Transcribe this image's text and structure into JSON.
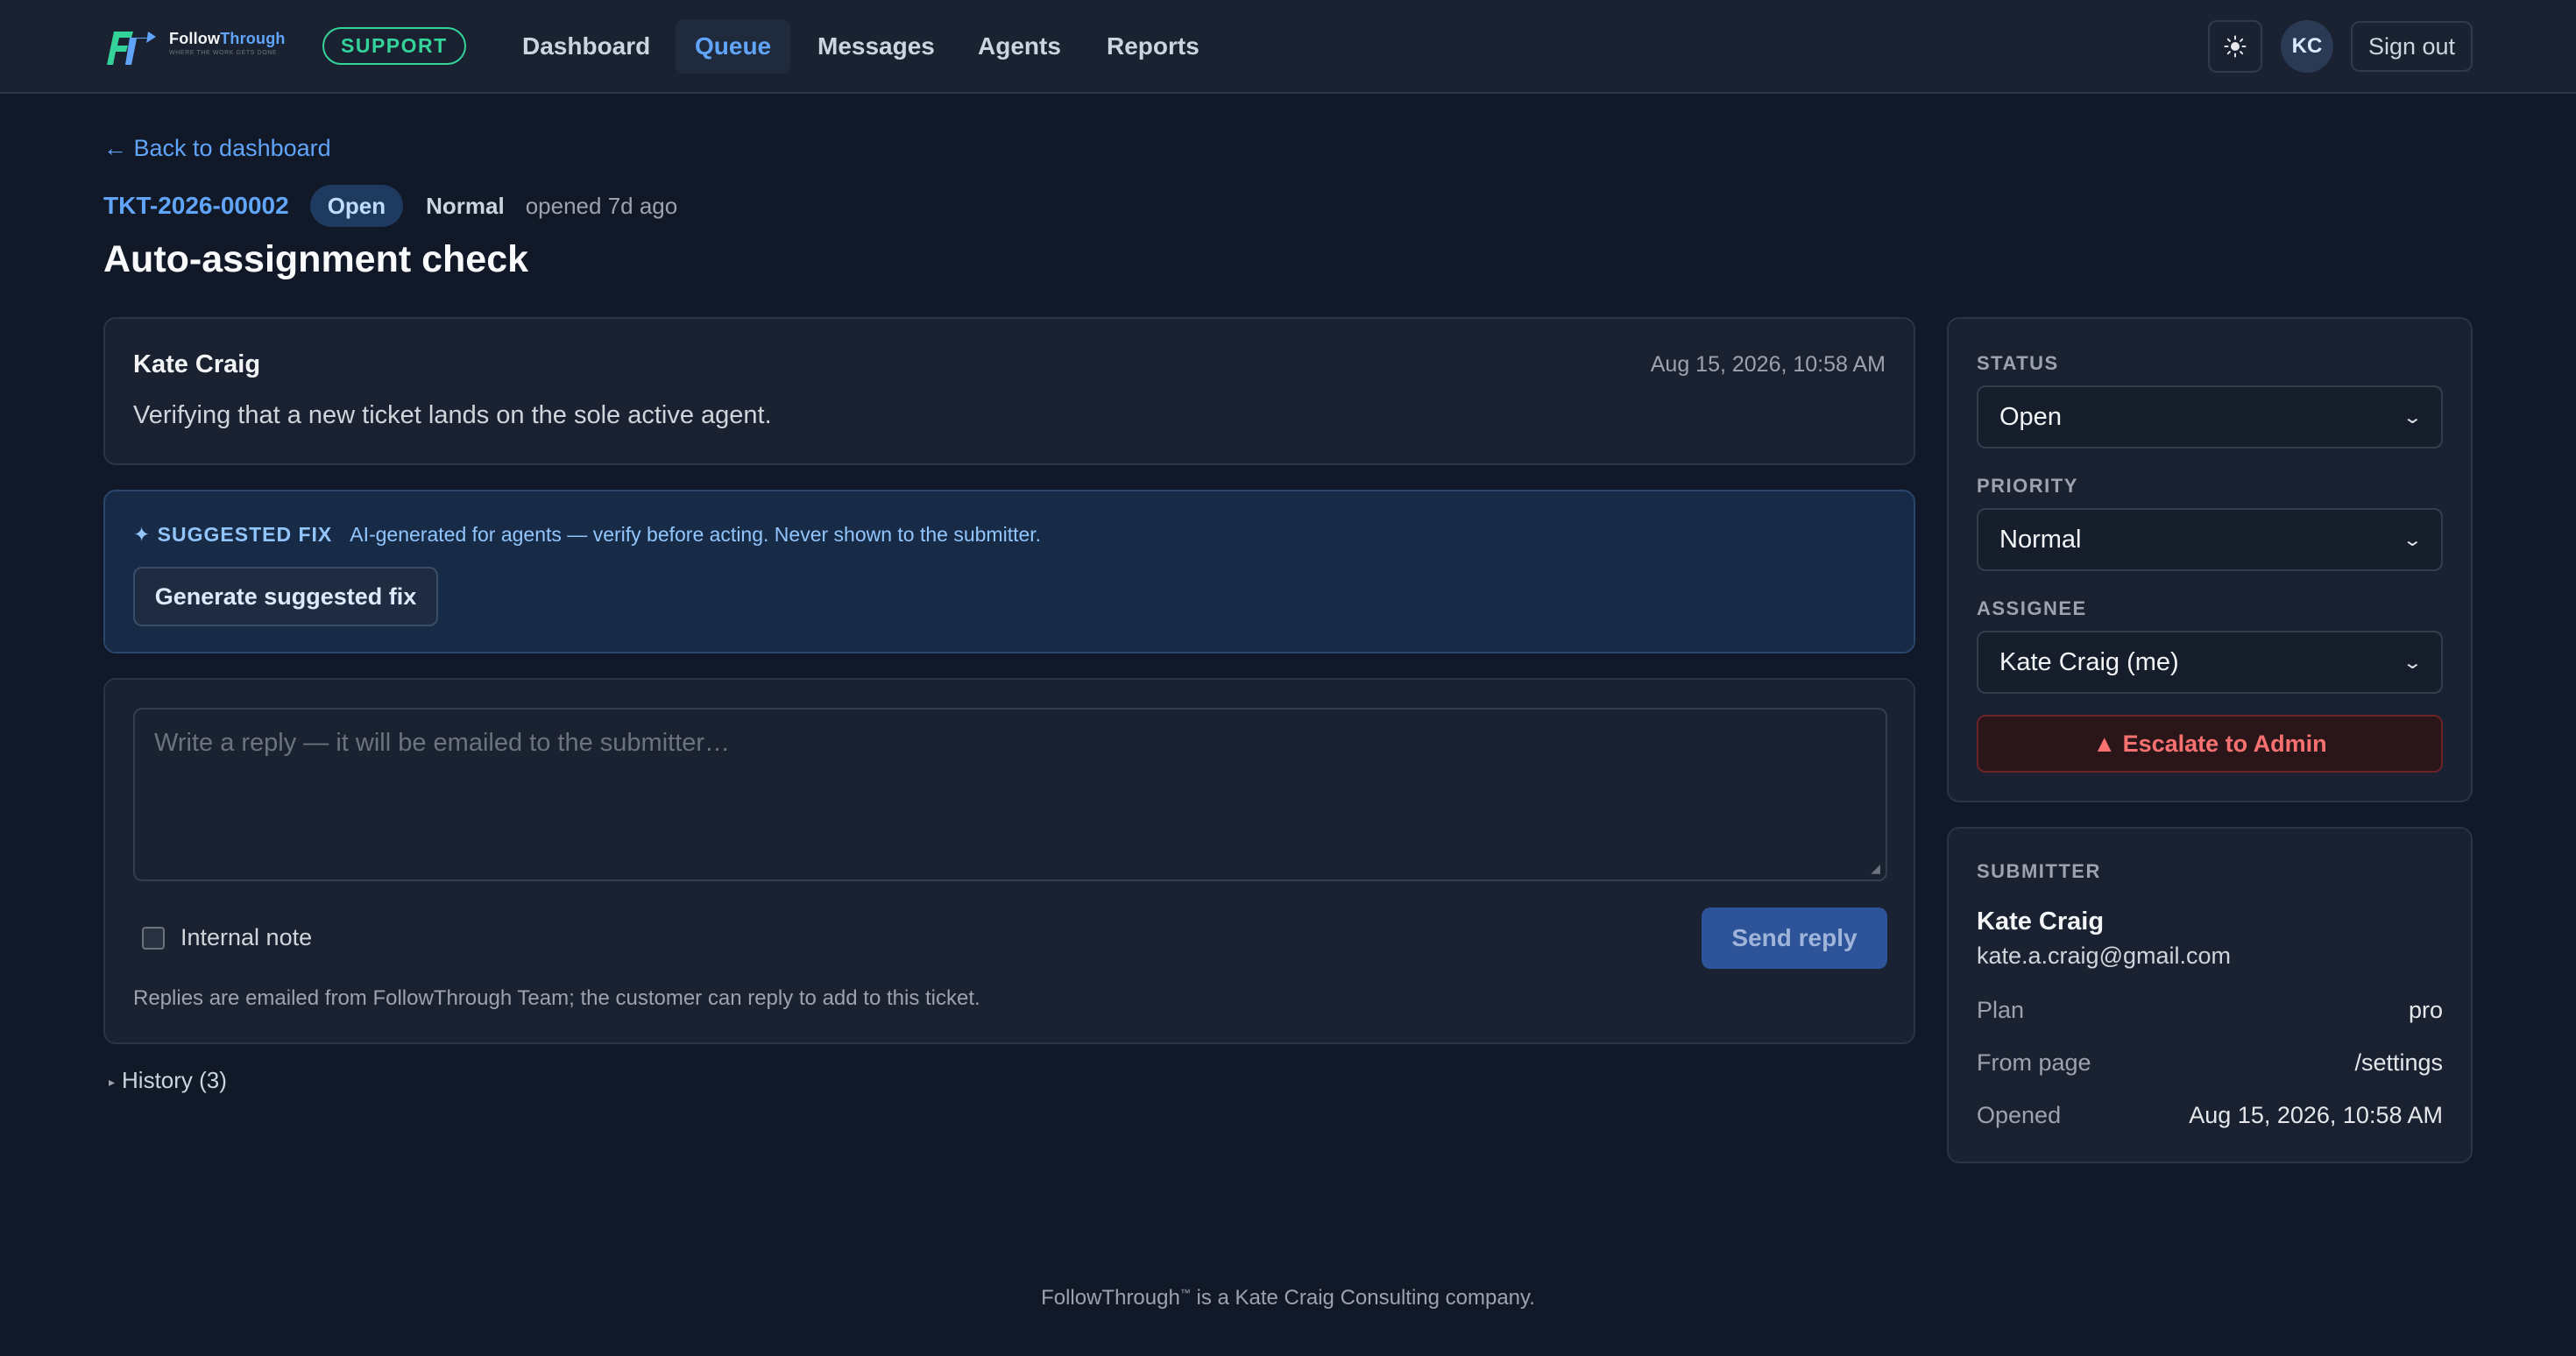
{
  "header": {
    "brand": {
      "name_part1": "Follow",
      "name_part2": "Through",
      "tagline": "WHERE THE WORK GETS DONE",
      "logo_initials": "FT"
    },
    "badge": "SUPPORT",
    "nav": [
      {
        "label": "Dashboard",
        "active": false
      },
      {
        "label": "Queue",
        "active": true
      },
      {
        "label": "Messages",
        "active": false
      },
      {
        "label": "Agents",
        "active": false
      },
      {
        "label": "Reports",
        "active": false
      }
    ],
    "theme_icon": "sun-icon",
    "avatar_initials": "KC",
    "signout_label": "Sign out"
  },
  "page": {
    "back_label": "← Back to dashboard",
    "ticket_id": "TKT-2026-00002",
    "status": "Open",
    "priority": "Normal",
    "opened": "opened 7d ago",
    "title": "Auto-assignment check"
  },
  "message": {
    "author": "Kate Craig",
    "time": "Aug 15, 2026, 10:58 AM",
    "body": "Verifying that a new ticket lands on the sole active agent."
  },
  "suggested_fix": {
    "label": "✦ SUGGESTED FIX",
    "note": "AI-generated for agents — verify before acting. Never shown to the submitter.",
    "button": "Generate suggested fix"
  },
  "reply": {
    "placeholder": "Write a reply — it will be emailed to the submitter…",
    "internal_note_label": "Internal note",
    "internal_note_checked": false,
    "send_label": "Send reply",
    "hint": "Replies are emailed from FollowThrough Team; the customer can reply to add to this ticket."
  },
  "history_label": "History (3)",
  "sidebar": {
    "status": {
      "label": "STATUS",
      "value": "Open"
    },
    "priority": {
      "label": "PRIORITY",
      "value": "Normal"
    },
    "assignee": {
      "label": "ASSIGNEE",
      "value": "Kate Craig (me)"
    },
    "escalate_label": "▲ Escalate to Admin",
    "submitter": {
      "label": "SUBMITTER",
      "name": "Kate Craig",
      "email": "kate.a.craig@gmail.com",
      "rows": [
        {
          "key": "Plan",
          "value": "pro"
        },
        {
          "key": "From page",
          "value": "/settings"
        },
        {
          "key": "Opened",
          "value": "Aug 15, 2026, 10:58 AM"
        }
      ]
    }
  },
  "footer": {
    "brand": "FollowThrough",
    "tm": "™",
    "rest": " is a Kate Craig Consulting company."
  },
  "colors": {
    "background": "#111827",
    "accent": "#60a5fa",
    "support_green": "#34d399",
    "danger": "#f87171"
  }
}
